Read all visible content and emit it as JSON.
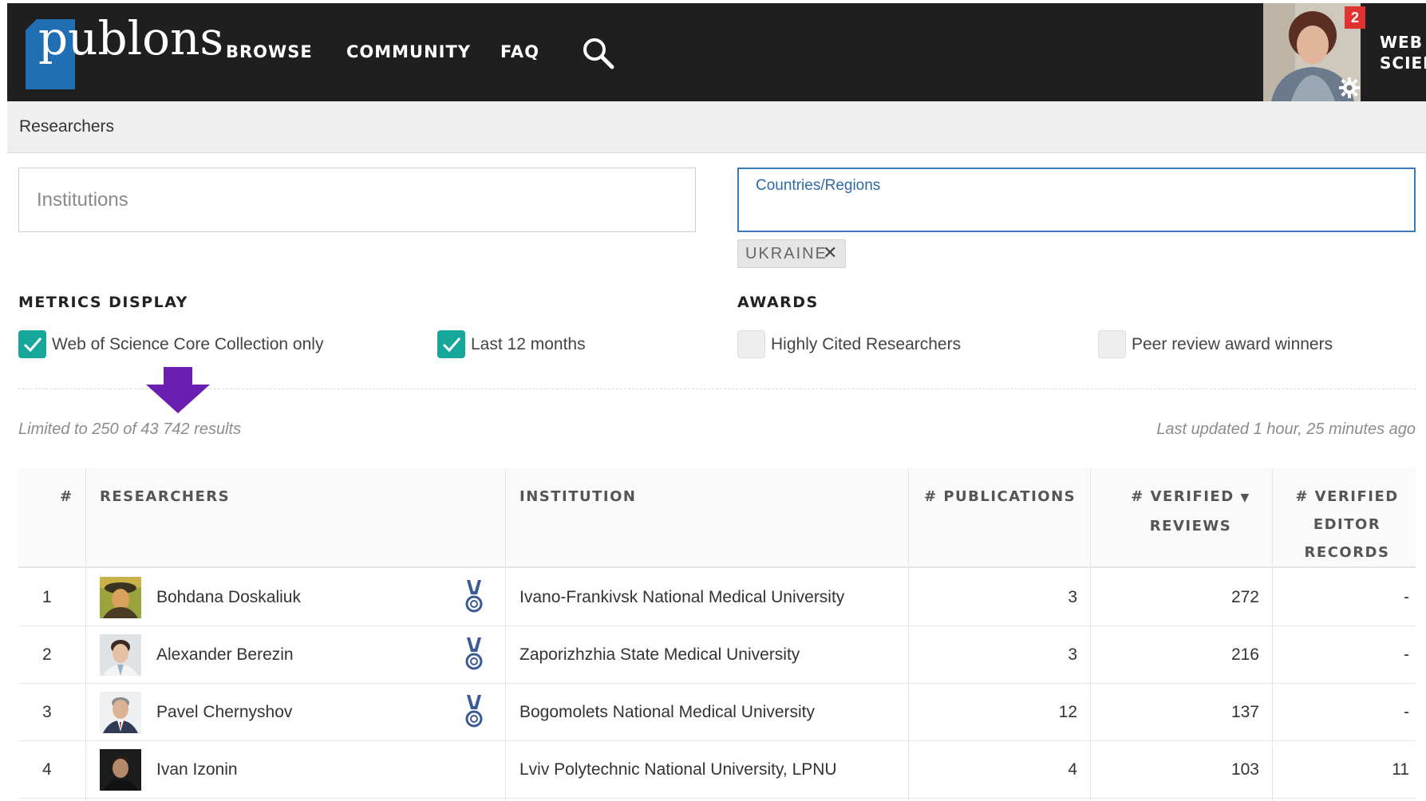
{
  "nav": {
    "logo_text": "publons",
    "links": [
      "BROWSE",
      "COMMUNITY",
      "FAQ"
    ],
    "notifications": "2",
    "wos_line1": "WEB OF",
    "wos_line2": "SCIENCE"
  },
  "breadcrumb": "Researchers",
  "filters": {
    "institutions_placeholder": "Institutions",
    "countries_label": "Countries/Regions",
    "country_tag": "UKRAINE",
    "tag_remove": "✕"
  },
  "metrics": {
    "title": "METRICS DISPLAY",
    "wos_only": "Web of Science Core Collection only",
    "last12": "Last 12 months"
  },
  "awards": {
    "title": "AWARDS",
    "highly_cited": "Highly Cited Researchers",
    "peer_review": "Peer review award winners"
  },
  "results": {
    "limited": "Limited to 250 of 43 742 results",
    "updated": "Last updated 1 hour, 25 minutes ago"
  },
  "table": {
    "headers": {
      "rank": "#",
      "researchers": "RESEARCHERS",
      "institution": "INSTITUTION",
      "publications": "# PUBLICATIONS",
      "reviews_l1": "# VERIFIED",
      "reviews_sort": "▼",
      "reviews_l2": "REVIEWS",
      "editor_l1": "# VERIFIED",
      "editor_l2": "EDITOR",
      "editor_l3": "RECORDS"
    },
    "rows": [
      {
        "rank": "1",
        "name": "Bohdana Doskaliuk",
        "institution": "Ivano-Frankivsk National Medical University",
        "publications": "3",
        "reviews": "272",
        "editor": "-"
      },
      {
        "rank": "2",
        "name": "Alexander Berezin",
        "institution": "Zaporizhzhia State Medical University",
        "publications": "3",
        "reviews": "216",
        "editor": "-"
      },
      {
        "rank": "3",
        "name": "Pavel Chernyshov",
        "institution": "Bogomolets National Medical University",
        "publications": "12",
        "reviews": "137",
        "editor": "-"
      },
      {
        "rank": "4",
        "name": "Ivan Izonin",
        "institution": "Lviv Polytechnic National University, LPNU",
        "publications": "4",
        "reviews": "103",
        "editor": "11"
      }
    ]
  },
  "colors": {
    "nav_bg": "#1f1f1f",
    "logo_blue": "#1f6fb2",
    "checkbox_teal": "#15a89a",
    "link_blue": "#2f6aa8",
    "arrow_purple": "#6a1fb0",
    "badge_red": "#e0322f"
  },
  "icons": [
    "search-icon",
    "gear-icon",
    "check-icon",
    "arrow-down-icon",
    "medal-icon",
    "close-icon"
  ]
}
